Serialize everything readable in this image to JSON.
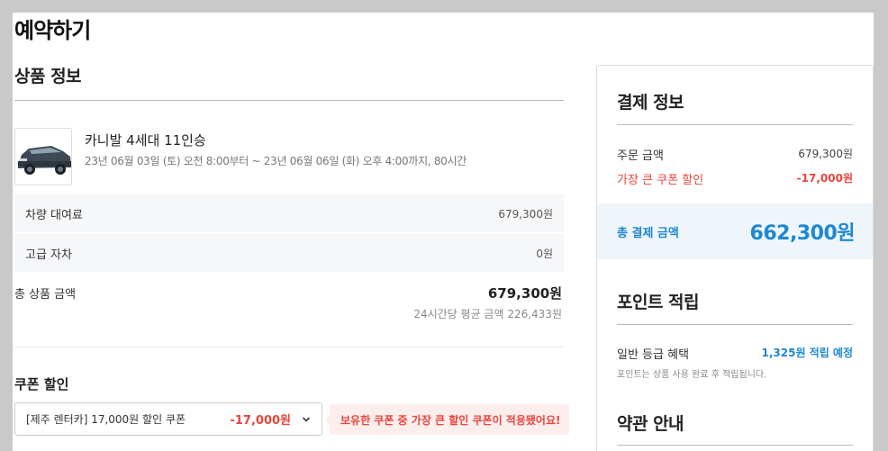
{
  "page": {
    "title": "예약하기"
  },
  "product_section": {
    "title": "상품 정보",
    "name": "카니발 4세대 11인승",
    "period": "23년 06월 03일 (토) 오전 8:00부터 ~ 23년 06월 06일 (화) 오후 4:00까지, 80시간",
    "rows": [
      {
        "label": "차량 대여료",
        "value": "679,300원"
      },
      {
        "label": "고급 자차",
        "value": "0원"
      }
    ],
    "total_label": "총 상품 금액",
    "total_value": "679,300원",
    "avg_note": "24시간당 평균 금액 226,433원"
  },
  "coupon": {
    "title": "쿠폰 할인",
    "selected_label": "[제주 렌터카] 17,000원 할인 쿠폰",
    "selected_amount": "-17,000원",
    "note": "보유한 쿠폰 중 가장 큰 할인 쿠폰이 적용됐어요!"
  },
  "payment": {
    "title": "결제 정보",
    "order_label": "주문 금액",
    "order_value": "679,300원",
    "discount_label": "가장 큰 쿠폰 할인",
    "discount_value": "-17,000원",
    "total_label": "총 결제 금액",
    "total_value": "662,300원"
  },
  "points": {
    "title": "포인트 적립",
    "label": "일반 등급 혜택",
    "value": "1,325원 적립 예정",
    "note": "포인트는 상품 사용 완료 후 적립됩니다."
  },
  "terms": {
    "title": "약관 안내"
  },
  "colors": {
    "accent_blue": "#1e88d2",
    "discount_red": "#e8453c"
  }
}
